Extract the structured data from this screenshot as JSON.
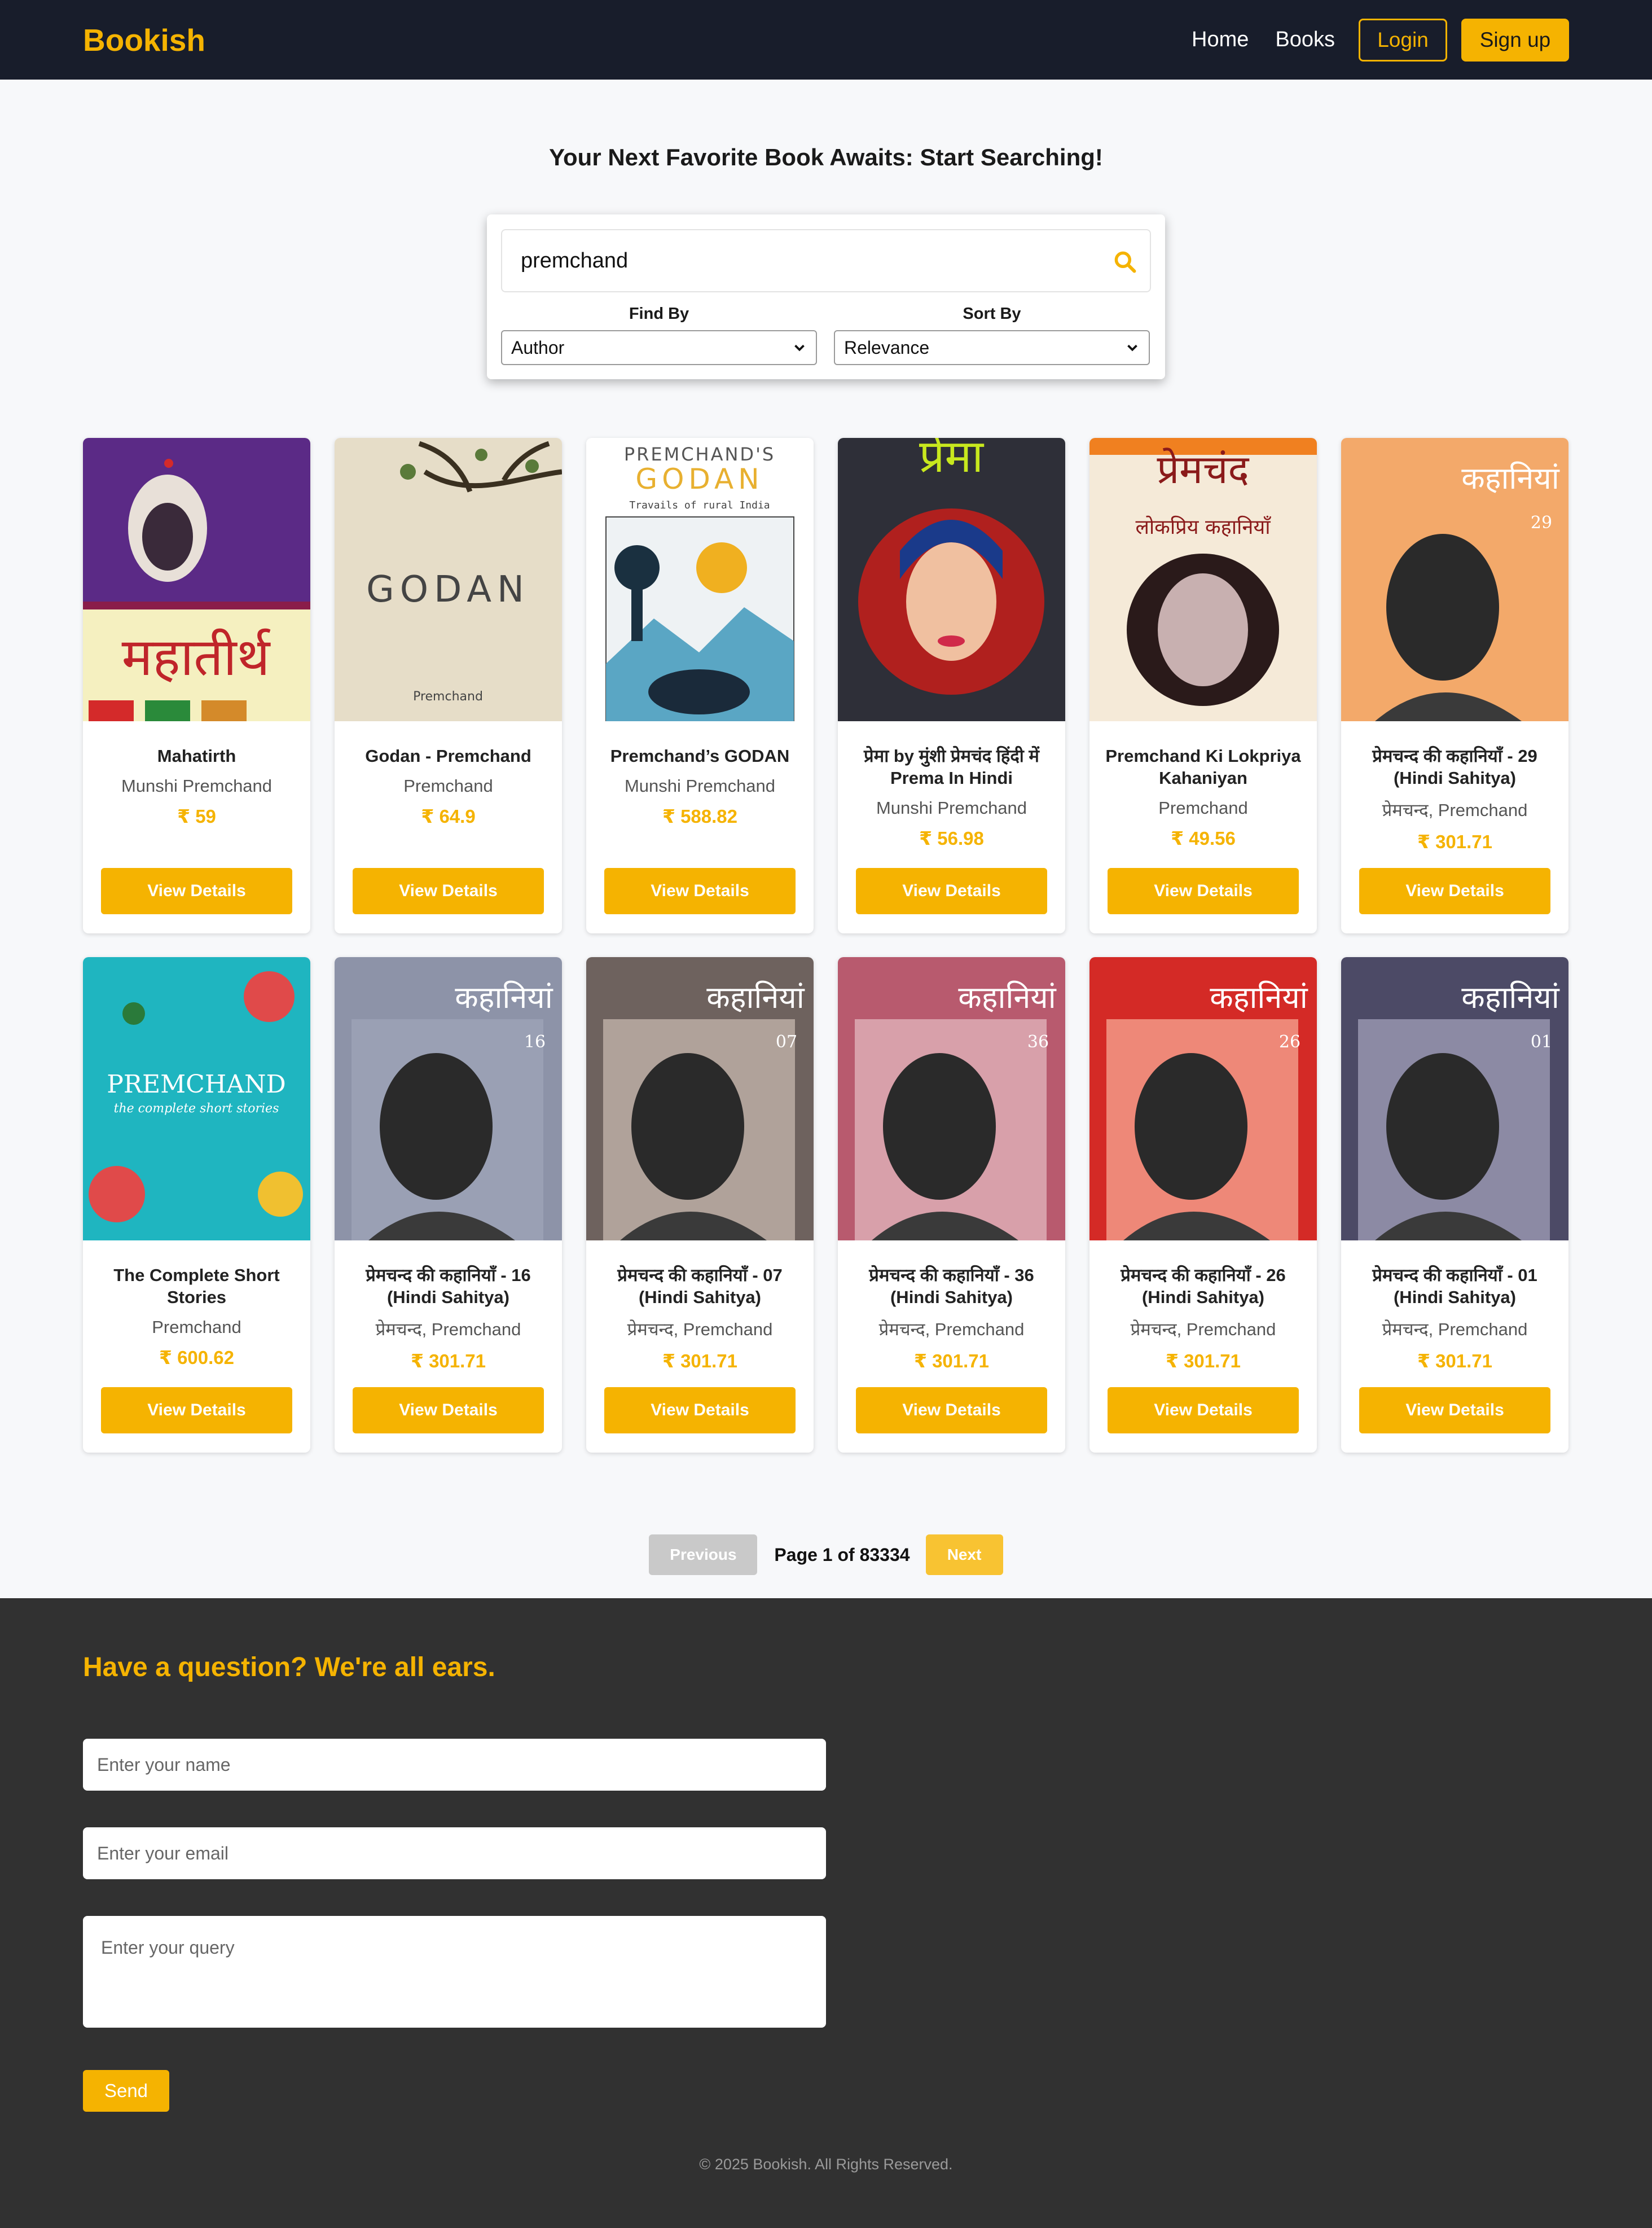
{
  "nav": {
    "brand": "Bookish",
    "links": [
      "Home",
      "Books"
    ],
    "login": "Login",
    "signup": "Sign up"
  },
  "hero": {
    "title": "Your Next Favorite Book Awaits: Start Searching!"
  },
  "search": {
    "value": "premchand",
    "find_label": "Find By",
    "find_value": "Author",
    "sort_label": "Sort By",
    "sort_value": "Relevance"
  },
  "books": [
    {
      "title": "Mahatirth",
      "author": "Munshi Premchand",
      "price": "₹ 59",
      "button": "View Details",
      "cover_text": "महातीर्थ"
    },
    {
      "title": "Godan - Premchand",
      "author": "Premchand",
      "price": "₹ 64.9",
      "button": "View Details",
      "cover_text": "GODAN",
      "cover_sub": "Premchand"
    },
    {
      "title": "Premchand’s GODAN",
      "author": "Munshi Premchand",
      "price": "₹ 588.82",
      "button": "View Details",
      "cover_text": "GODAN",
      "cover_top": "PREMCHAND'S",
      "cover_sub": "Travails of rural India"
    },
    {
      "title": "प्रेमा by मुंशी प्रेमचंद हिंदी में Prema In Hindi",
      "author": "Munshi Premchand",
      "price": "₹ 56.98",
      "button": "View Details",
      "cover_text": "प्रेमा"
    },
    {
      "title": "Premchand Ki Lokpriya Kahaniyan",
      "author": "Premchand",
      "price": "₹ 49.56",
      "button": "View Details",
      "cover_text": "प्रेमचंद",
      "cover_sub": "लोकप्रिय कहानियाँ"
    },
    {
      "title": "प्रेमचन्द की कहानियाँ - 29 (Hindi Sahitya)",
      "author": "प्रेमचन्द, Premchand",
      "price": "₹ 301.71",
      "button": "View Details",
      "cover_text": "कहानियां",
      "cover_num": "29"
    },
    {
      "title": "The Complete Short Stories",
      "author": "Premchand",
      "price": "₹ 600.62",
      "button": "View Details",
      "cover_text": "PREMCHAND",
      "cover_sub": "the complete short stories"
    },
    {
      "title": "प्रेमचन्द की कहानियाँ - 16 (Hindi Sahitya)",
      "author": "प्रेमचन्द, Premchand",
      "price": "₹ 301.71",
      "button": "View Details",
      "cover_text": "कहानियां",
      "cover_num": "16"
    },
    {
      "title": "प्रेमचन्द की कहानियाँ - 07 (Hindi Sahitya)",
      "author": "प्रेमचन्द, Premchand",
      "price": "₹ 301.71",
      "button": "View Details",
      "cover_text": "कहानियां",
      "cover_num": "07"
    },
    {
      "title": "प्रेमचन्द की कहानियाँ - 36 (Hindi Sahitya)",
      "author": "प्रेमचन्द, Premchand",
      "price": "₹ 301.71",
      "button": "View Details",
      "cover_text": "कहानियां",
      "cover_num": "36"
    },
    {
      "title": "प्रेमचन्द की कहानियाँ - 26 (Hindi Sahitya)",
      "author": "प्रेमचन्द, Premchand",
      "price": "₹ 301.71",
      "button": "View Details",
      "cover_text": "कहानियां",
      "cover_num": "26"
    },
    {
      "title": "प्रेमचन्द की कहानियाँ - 01 (Hindi Sahitya)",
      "author": "प्रेमचन्द, Premchand",
      "price": "₹ 301.71",
      "button": "View Details",
      "cover_text": "कहानियां",
      "cover_num": "01"
    }
  ],
  "pagination": {
    "previous": "Previous",
    "info": "Page 1 of 83334",
    "next": "Next"
  },
  "contact": {
    "title": "Have a question? We're all ears.",
    "name_placeholder": "Enter your name",
    "email_placeholder": "Enter your email",
    "query_placeholder": "Enter your query",
    "send": "Send"
  },
  "footer": {
    "copyright": "© 2025 Bookish. All Rights Reserved."
  },
  "colors": {
    "accent": "#f5b301",
    "nav_bg": "#181d2b",
    "footer_bg": "#313131"
  }
}
